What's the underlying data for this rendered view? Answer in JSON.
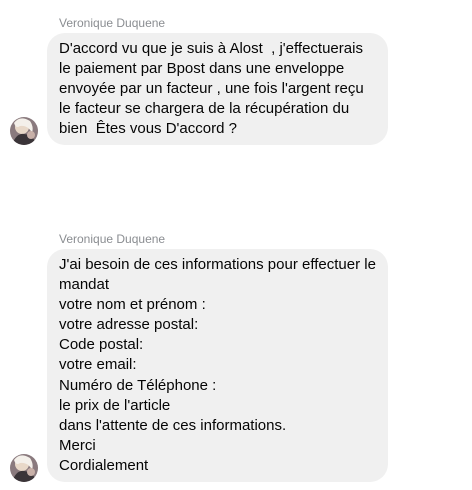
{
  "messages": [
    {
      "sender": "Veronique Duquene",
      "text": "D'accord vu que je suis à Alost  , j'effectuerais le paiement par Bpost dans une enveloppe envoyée par un facteur , une fois l'argent reçu le facteur se chargera de la récupération du bien  Êtes vous D'accord ?"
    },
    {
      "sender": "Veronique Duquene",
      "text": "J'ai besoin de ces informations pour effectuer le mandat\nvotre nom et prénom :\nvotre adresse postal:\nCode postal:\nvotre email:\nNuméro de Téléphone :\nle prix de l'article\ndans l'attente de ces informations.\nMerci\nCordialement"
    }
  ],
  "colors": {
    "bubble_bg": "#f0f0f0",
    "sender_name": "#8a8d91",
    "text": "#050505"
  },
  "icons": {
    "avatar": "profile-photo"
  }
}
